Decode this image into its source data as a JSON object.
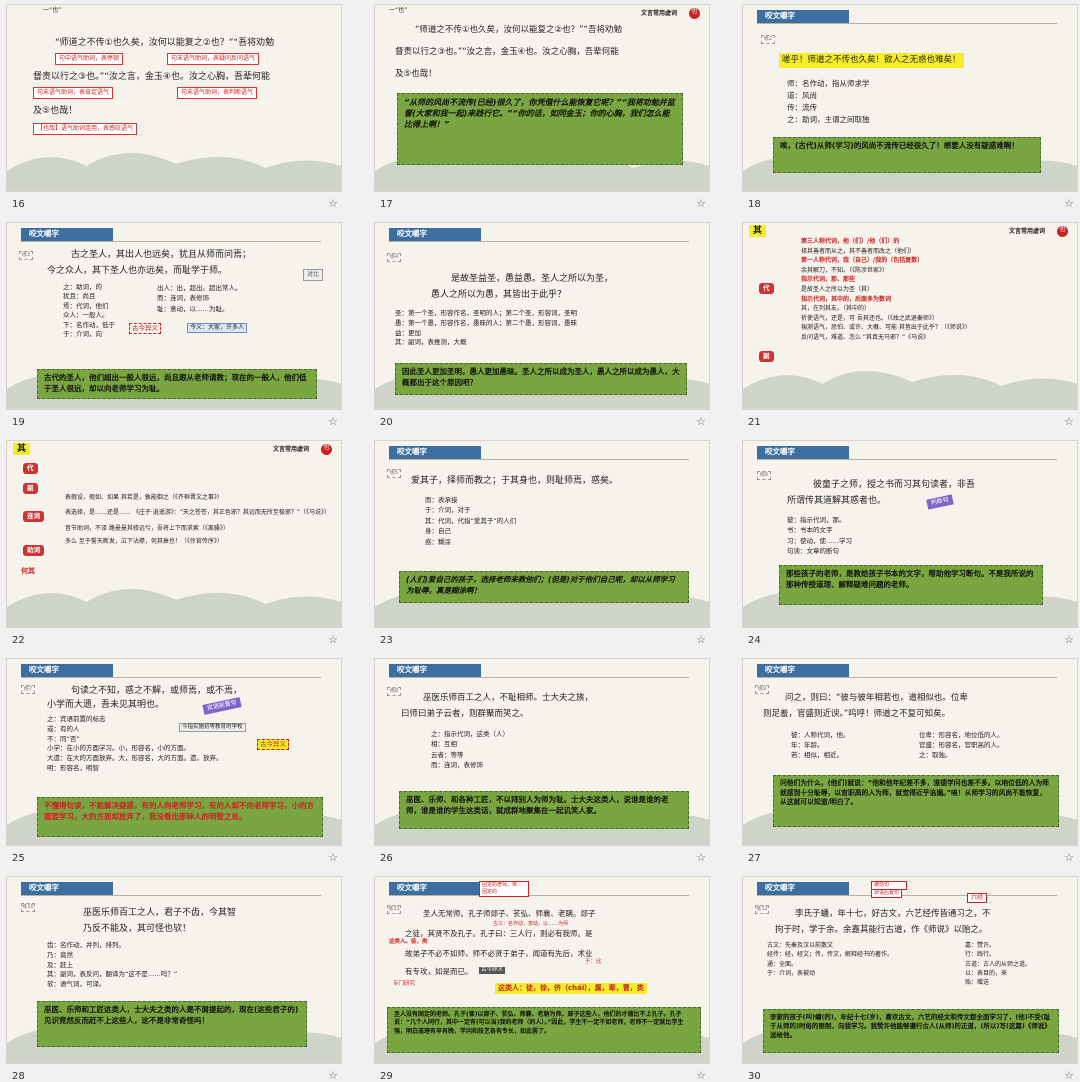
{
  "slides": [
    {
      "num": "16",
      "tag": "一“也”",
      "l1": "“师道之不传①也久矣，汝何以能复之②也？”“吾将劝勉",
      "l2": "督责以行之③也。”“汝之言，金玉④也。汝之心胸，吾辈何能",
      "l3": "及⑤也哉！",
      "n1": "句中语气助词，表停顿",
      "n2": "句末语气助词，表疑问反问语气",
      "n3": "句末语气助词，表肯定语气",
      "n4": "句末语气助词，表判断语气",
      "n5": "【也哉】语气助词连用，表感叹语气"
    },
    {
      "num": "17",
      "tag": "一“也”",
      "title": "文言常用虚词",
      "seal": "也",
      "l1": "“师道之不传①也久矣，汝何以能复之②也？”“吾将劝勉",
      "l2": "督责以行之③也。”“汝之言，金玉④也。汝之心胸，吾辈何能",
      "l3": "及⑤也哉！",
      "green": "“从师的风尚不流传(已经)很久了，你凭借什么能恢复它呢？”“我将劝勉并监督(大家和我一起)来践行它。”“你的话，如同金玉；你的心胸，我们怎么能比得上啊！”"
    },
    {
      "num": "18",
      "hdr": "咬文嚼字",
      "tag": "练2",
      "quote": "嗟乎！师道之不传也久矣！欲人之无惑也难矣！",
      "d": [
        "师：名作动，指从师求学",
        "道：风尚",
        "传：流传",
        "之：助词，主谓之间取独"
      ],
      "green": "唉，(古代)从师(学习)的风尚不流传已经很久了！想要人没有疑惑难啊！"
    },
    {
      "num": "19",
      "hdr": "咬文嚼字",
      "tag": "练3",
      "l1": "古之圣人，其出人也远矣，犹且从师而问焉；",
      "l2": "今之众人，其下圣人也亦远矣，而耻学于师。",
      "d1": [
        "之：助词，的",
        "犹且：尚且",
        "焉：代词，他们",
        "众人：一般人。",
        "下：名作动，低于",
        "于：介词，向"
      ],
      "d2": [
        "出人：出，超出。超出常人。",
        "而：连词，表修饰",
        "耻：意动，以……为耻。"
      ],
      "red": "古今异义",
      "note": "今义：大家，许多人",
      "side": "对比",
      "green": "古代的圣人，他们超出一般人很远，尚且跟从老师请教；现在的一般人，他们低于圣人很远，却以向老师学习为耻。"
    },
    {
      "num": "20",
      "hdr": "咬文嚼字",
      "tag": "练4",
      "l1": "是故圣益圣，愚益愚。圣人之所以为圣，",
      "l2": "愚人之所以为愚，其皆出于此乎？",
      "d": [
        "圣：第一个圣，形容作名，圣明的人；第二个圣，形容词，圣明",
        "愚：第一个愚，形容作名，愚昧的人；第二个愚，形容词，愚昧",
        "益：更加",
        "其：副词，表推测，大概"
      ],
      "green": "因此圣人更加圣明，愚人更加愚昧。圣人之所以成为圣人，愚人之所以成为愚人，大概都出于这个原因吧？"
    },
    {
      "num": "21",
      "tag": "其",
      "title": "文言常用虚词",
      "seal": "也",
      "p1": "代",
      "p2": "副",
      "a": [
        "第三人称代词，他（们）/他（们）的",
        "择其善者而从之，其不善者而改之（他们）",
        "第一人称代词，我（自己）/我的（包括复数）",
        "余其解刀，不知。（《陈涉世家》）",
        "指示代词，那、那些",
        "是故圣人之所以为圣（其）",
        "指示代词，其中的，后面多为数词",
        "其，在列其友。（其中的）",
        "祈使语气，还是，可 吾其还也。（《烛之武退秦师》）",
        "揣测语气，恐怕、或许、大概、可能 其皆出于此乎？（《师说》）",
        "反问语气，难道、怎么 “其真无马邪？”《马说》"
      ]
    },
    {
      "num": "22",
      "tag": "其",
      "title": "文言常用虚词",
      "seal": "也",
      "p1": "代",
      "p2": "副",
      "p3": "连词",
      "p4": "助词",
      "p5": "何其",
      "a": [
        "表假设，假如、如果 其若是，孰能御之（《齐桓晋文之事》）",
        "表选择，是……还是…… 《庄子·逍遥游》：“天之苍苍，其正色邪？其远而无所至极邪？”（《马说》）",
        "音节助词，不译 路曼曼其修远兮，吾将上下而求索（《离骚》）",
        "多么 至于誓天断发，泣下沾襟，何其衰也！（《伶官传序》）"
      ]
    },
    {
      "num": "23",
      "hdr": "咬文嚼字",
      "tag": "练5",
      "l1": "爱其子，择师而教之；于其身也，则耻师焉，惑矣。",
      "d": [
        "而：表承接",
        "于：介词，对于",
        "其：代词，代指“爱其子”的人们",
        "身：自己",
        "惑：糊涂"
      ],
      "green": "(人们)爱自己的孩子，选择老师来教他们；(但是)对于他们自己呢，却以从师学习为耻辱，真是糊涂啊！"
    },
    {
      "num": "24",
      "hdr": "咬文嚼字",
      "tag": "练6",
      "l1": "彼童子之师，授之书而习其句读者，非吾",
      "l2": "所谓传其道解其惑者也。",
      "side": "判断句",
      "d": [
        "彼：指示代词，那。",
        "书：书本的文字",
        "习：使动，使……学习",
        "句读：文章的断句"
      ],
      "green": "那些孩子的老师，是教给孩子书本的文字，帮助他学习断句。不是我所说的那种传授道理、解释疑难问题的老师。"
    },
    {
      "num": "25",
      "hdr": "咬文嚼字",
      "tag": "练7",
      "l1": "句读之不知，惑之不解，或师焉，或不焉，",
      "l2": "小学而大遗，吾未见其明也。",
      "badge": "宾语前置句",
      "sub": "今指实施初等教育的学校",
      "d": [
        "之：宾语前置的标志",
        "或：有的人",
        "不：同“否”",
        "小学：在小的方面学习。小，形容名，小的方面。",
        "大遗：在大的方面放弃。大，形容名，大的方面。遗，放弃。",
        "明：形容名，明智"
      ],
      "red": "古今异义",
      "green": "不懂得句读，不能解决疑惑，有的人向老师学习，有的人却不向老师学习，小的方面要学习，大的方面却放弃了，我没看出那种人的明智之处。"
    },
    {
      "num": "26",
      "hdr": "咬文嚼字",
      "tag": "练8",
      "l1": "巫医乐师百工之人，不耻相师。士大夫之族，",
      "l2": "曰师曰弟子云者，则群聚而笑之。",
      "d": [
        "之：指示代词，这类（人）",
        "相：互相",
        "云者：等等",
        "而：连词，表修饰"
      ],
      "green": "巫医、乐师、和各种工匠，不以拜别人为师为耻。士大夫这类人，说谁是谁的老师，谁是谁的学生这类话，就成群地聚集在一起讥笑人家。"
    },
    {
      "num": "27",
      "hdr": "咬文嚼字",
      "tag": "练9",
      "l1": "问之，则曰：“彼与彼年相若也，道相似也。位卑",
      "l2": "则足羞，官盛则近谀。”呜呼！师道之不复可知矣。",
      "d1": [
        "彼：人称代词，他。",
        "年：年龄。",
        "若：相似，相近。"
      ],
      "d2": [
        "位卑：形容名，地位低的人。",
        "官盛：形容名，官职高的人。",
        "之：取独。"
      ],
      "green": "问他们为什么，(他们)就说：“他和他年纪差不多，道德学问也差不多。以地位低的人为师就感到十分耻辱，以官职高的人为师，就觉得近乎谄媚。”唉！从师学习的风尚不能恢复，从这就可以知道/明白了。"
    },
    {
      "num": "28",
      "hdr": "咬文嚼字",
      "tag": "练10",
      "l1": "巫医乐师百工之人，君子不齿，今其智",
      "l2": "乃反不能及，其可怪也欤！",
      "d": [
        "齿：名作动，并列，排列。",
        "乃：竟然",
        "及：赶上",
        "其：副词，表反问，翻译为“这不是……吗？”",
        "欤：语气词，可译。"
      ],
      "green": "巫医、乐师和工匠这类人，士大夫之类的人是不屑提起的，现在(这些君子的)见识竟然反而赶不上这些人，这不是非常奇怪吗！"
    },
    {
      "num": "29",
      "hdr": "咬文嚼字",
      "tag": "练11",
      "l1": "圣人无常师。孔子师郯子、苌弘、师襄、老聃。郯子",
      "l2": "之徒，其贤不及孔子。孔子曰：三人行，则必有我师。是",
      "l3": "故弟子不必不如师，师不必贤于弟子，闻道有先后，术业",
      "l4": "有专攻，如是而已。",
      "callout": "固定的老师。常：固定的",
      "n1": "这类人。徒，类",
      "n2": "古今异义",
      "n3": "专门研究",
      "n4": "于：比",
      "yl": "古义：名作动，意动，以……为师",
      "band": "这类人：徒，徐，侪（chái），属，辈，曹，类",
      "green": "圣人没有固定的老师。孔子(曾)以郯子、苌弘、师襄、老聃为师。郯子这些人，他们的才德比不上孔子。孔子说：“几个人同行，其中一定有(可以当)我的老师（的人）。”因此，学生不一定不如老师，老师不一定就比学生强，明白道理有早有晚，学问和技艺各有专长，如此罢了。"
    },
    {
      "num": "30",
      "hdr": "咬文嚼字",
      "tag": "练12",
      "l1": "李氏子蟠，年十七，好古文，六艺经传皆通习之，不",
      "l2": "拘于时，学于余。余嘉其能行古道，作《师说》以贻之。",
      "c1": "被动句",
      "c2": "状语后置句",
      "c3": "六经",
      "d1": [
        "古文：先秦及汉以前散文",
        "经传：经，经文；传，传文，解释经书的著作。",
        "通：全面。",
        "于：介词，表被动"
      ],
      "d2": [
        "嘉：赞许。",
        "行：践行。",
        "古道：古人的从师之道。",
        "以：表目的，来",
        "贻：赠送"
      ],
      "green": "李家的孩子(叫)蟠(的)，年纪十七(岁)，喜欢古文，六艺的经文和传文都全面学习了，(他)不受(耻于从师的)时俗的限制，向我学习。我赞许他能够遵行古人(从师)的正道，(所以)写(这篇)《师说》送给他。"
    }
  ]
}
